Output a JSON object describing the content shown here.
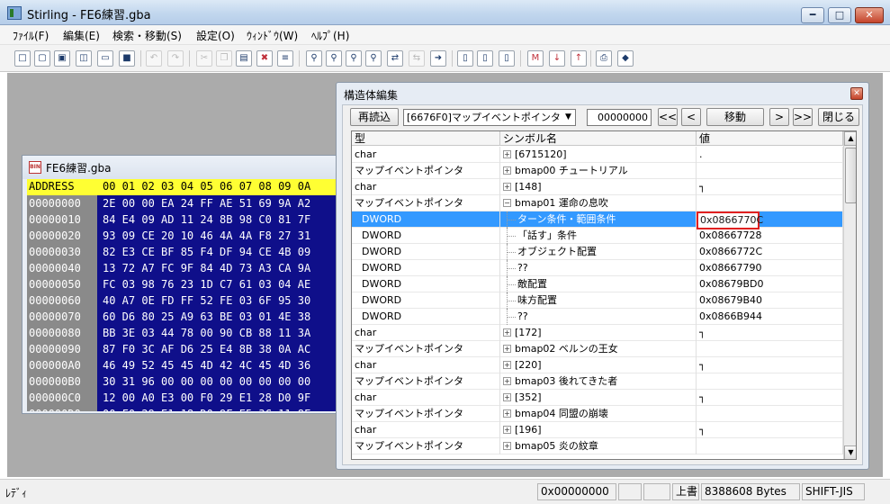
{
  "window": {
    "title": "Stirling - FE6練習.gba",
    "controls": [
      "━",
      "□",
      "✕"
    ]
  },
  "menu": [
    "ﾌｧｲﾙ(F)",
    "編集(E)",
    "検索・移動(S)",
    "設定(O)",
    "ｳｨﾝﾄﾞｳ(W)",
    "ﾍﾙﾌﾟ(H)"
  ],
  "toolbar": [
    {
      "icon": "new-file-icon",
      "glyph": "□"
    },
    {
      "icon": "new-file-2-icon",
      "glyph": "▢"
    },
    {
      "icon": "new-file-3-icon",
      "glyph": "▣"
    },
    {
      "icon": "new-file-4-icon",
      "glyph": "◫"
    },
    {
      "icon": "open-folder-icon",
      "glyph": "▭"
    },
    {
      "icon": "save-icon",
      "glyph": "■"
    },
    {
      "icon": "undo-icon",
      "glyph": "↶"
    },
    {
      "icon": "redo-icon",
      "glyph": "↷"
    },
    {
      "icon": "cut-icon",
      "glyph": "✂"
    },
    {
      "icon": "copy-icon",
      "glyph": "❐"
    },
    {
      "icon": "paste-icon",
      "glyph": "▤"
    },
    {
      "icon": "delete-icon",
      "glyph": "✖"
    },
    {
      "icon": "struct-edit-icon",
      "glyph": "≡"
    },
    {
      "icon": "find-icon",
      "glyph": "⚲"
    },
    {
      "icon": "find-next-icon",
      "glyph": "⚲"
    },
    {
      "icon": "find-prev-icon",
      "glyph": "⚲"
    },
    {
      "icon": "find-all-icon",
      "glyph": "⚲"
    },
    {
      "icon": "replace-icon",
      "glyph": "⇄"
    },
    {
      "icon": "replace-all-icon",
      "glyph": "⇆"
    },
    {
      "icon": "jump-icon",
      "glyph": "➜"
    },
    {
      "icon": "page-1-icon",
      "glyph": "▯"
    },
    {
      "icon": "page-2-icon",
      "glyph": "▯"
    },
    {
      "icon": "page-3-icon",
      "glyph": "▯"
    },
    {
      "icon": "mark-icon",
      "glyph": "M"
    },
    {
      "icon": "mark-next-icon",
      "glyph": "↓"
    },
    {
      "icon": "mark-prev-icon",
      "glyph": "↑"
    },
    {
      "icon": "print-icon",
      "glyph": "⎙"
    },
    {
      "icon": "settings-icon",
      "glyph": "◆"
    }
  ],
  "hex_window": {
    "title": "FE6練習.gba",
    "header_label": "ADDRESS",
    "header_cols": "00 01 02 03 04 05 06 07 08 09 0A",
    "rows": [
      {
        "addr": "00000000",
        "bytes": "2E 00 00 EA 24 FF AE 51 69 9A A2"
      },
      {
        "addr": "00000010",
        "bytes": "84 E4 09 AD 11 24 8B 98 C0 81 7F"
      },
      {
        "addr": "00000020",
        "bytes": "93 09 CE 20 10 46 4A 4A F8 27 31"
      },
      {
        "addr": "00000030",
        "bytes": "82 E3 CE BF 85 F4 DF 94 CE 4B 09"
      },
      {
        "addr": "00000040",
        "bytes": "13 72 A7 FC 9F 84 4D 73 A3 CA 9A"
      },
      {
        "addr": "00000050",
        "bytes": "FC 03 98 76 23 1D C7 61 03 04 AE"
      },
      {
        "addr": "00000060",
        "bytes": "40 A7 0E FD FF 52 FE 03 6F 95 30"
      },
      {
        "addr": "00000070",
        "bytes": "60 D6 80 25 A9 63 BE 03 01 4E 38"
      },
      {
        "addr": "00000080",
        "bytes": "BB 3E 03 44 78 00 90 CB 88 11 3A"
      },
      {
        "addr": "00000090",
        "bytes": "87 F0 3C AF D6 25 E4 8B 38 0A AC"
      },
      {
        "addr": "000000A0",
        "bytes": "46 49 52 45 45 4D 42 4C 45 4D 36"
      },
      {
        "addr": "000000B0",
        "bytes": "30 31 96 00 00 00 00 00 00 00 00"
      },
      {
        "addr": "000000C0",
        "bytes": "12 00 A0 E3 00 F0 29 E1 28 D0 9F"
      },
      {
        "addr": "000000D0",
        "bytes": "00 F0 29 E1 18 D0 9F E5 3C 11 8F"
      }
    ]
  },
  "struct_window": {
    "title": "構造体編集",
    "reload_label": "再読込",
    "combo_value": "[6676F0]マップイベントポインタ",
    "address_value": "00000000",
    "nav_first": "<<",
    "nav_prev": "<",
    "move_label": "移動",
    "nav_next": ">",
    "nav_last": ">>",
    "close_label": "閉じる",
    "columns": [
      "型",
      "シンボル名",
      "値"
    ],
    "rows": [
      {
        "type": "char",
        "expander": "+",
        "symbol": "[6715120]",
        "value": ".",
        "child": false
      },
      {
        "type": "マップイベントポインタ",
        "expander": "+",
        "symbol": "bmap00 チュートリアル",
        "value": "",
        "child": false
      },
      {
        "type": "char",
        "expander": "+",
        "symbol": "[148]",
        "value": "┐",
        "child": false
      },
      {
        "type": "マップイベントポインタ",
        "expander": "−",
        "symbol": "bmap01 運命の息吹",
        "value": "",
        "child": false
      },
      {
        "type": "DWORD",
        "expander": "",
        "symbol": "ターン条件・範囲条件",
        "value": "0x0866770C",
        "child": true,
        "selected": true
      },
      {
        "type": "DWORD",
        "expander": "",
        "symbol": "「話す」条件",
        "value": "0x08667728",
        "child": true
      },
      {
        "type": "DWORD",
        "expander": "",
        "symbol": "オブジェクト配置",
        "value": "0x0866772C",
        "child": true
      },
      {
        "type": "DWORD",
        "expander": "",
        "symbol": "??",
        "value": "0x08667790",
        "child": true
      },
      {
        "type": "DWORD",
        "expander": "",
        "symbol": "敵配置",
        "value": "0x08679BD0",
        "child": true
      },
      {
        "type": "DWORD",
        "expander": "",
        "symbol": "味方配置",
        "value": "0x08679B40",
        "child": true
      },
      {
        "type": "DWORD",
        "expander": "",
        "symbol": "??",
        "value": "0x0866B944",
        "child": true
      },
      {
        "type": "char",
        "expander": "+",
        "symbol": "[172]",
        "value": "┐",
        "child": false
      },
      {
        "type": "マップイベントポインタ",
        "expander": "+",
        "symbol": "bmap02 ベルンの王女",
        "value": "",
        "child": false
      },
      {
        "type": "char",
        "expander": "+",
        "symbol": "[220]",
        "value": "┐",
        "child": false
      },
      {
        "type": "マップイベントポインタ",
        "expander": "+",
        "symbol": "bmap03 後れてきた者",
        "value": "",
        "child": false
      },
      {
        "type": "char",
        "expander": "+",
        "symbol": "[352]",
        "value": "┐",
        "child": false
      },
      {
        "type": "マップイベントポインタ",
        "expander": "+",
        "symbol": "bmap04 同盟の崩壊",
        "value": "",
        "child": false
      },
      {
        "type": "char",
        "expander": "+",
        "symbol": "[196]",
        "value": "┐",
        "child": false
      },
      {
        "type": "マップイベントポインタ",
        "expander": "+",
        "symbol": "bmap05 炎の紋章",
        "value": "",
        "child": false
      }
    ]
  },
  "status": {
    "ready": "ﾚﾃﾞｨ",
    "offset": "0x00000000",
    "blank1": "",
    "blank2": "",
    "mode": "上書",
    "size": "8388608 Bytes",
    "encoding": "SHIFT-JIS"
  }
}
